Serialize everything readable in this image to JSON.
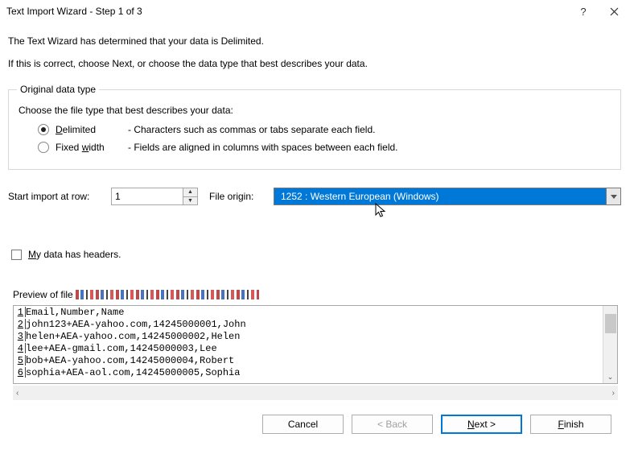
{
  "title": "Text Import Wizard - Step 1 of 3",
  "intro1": "The Text Wizard has determined that your data is Delimited.",
  "intro2": "If this is correct, choose Next, or choose the data type that best describes your data.",
  "fieldset": {
    "legend": "Original data type",
    "choose": "Choose the file type that best describes your data:",
    "delimited": {
      "letter": "D",
      "rest": "elimited",
      "desc": "- Characters such as commas or tabs separate each field."
    },
    "fixed": {
      "pre": "Fixed ",
      "letter": "w",
      "rest": "idth",
      "desc": "- Fields are aligned in columns with spaces between each field."
    }
  },
  "import_row": {
    "label": "Start import at row:",
    "value": "1",
    "origin_label": "File origin:",
    "origin_value": "1252 : Western European (Windows)"
  },
  "headers": {
    "letter": "M",
    "rest": "y data has headers."
  },
  "preview_label": "Preview of file ",
  "preview_lines": [
    "Email,Number,Name",
    "john123+AEA-yahoo.com,14245000001,John",
    "helen+AEA-yahoo.com,14245000002,Helen",
    "lee+AEA-gmail.com,14245000003,Lee",
    "bob+AEA-yahoo.com,14245000004,Robert",
    "sophia+AEA-aol.com,14245000005,Sophia"
  ],
  "buttons": {
    "cancel": "Cancel",
    "back": "< Back",
    "next_letter": "N",
    "next_rest": "ext >",
    "finish_letter": "F",
    "finish_rest": "inish"
  }
}
